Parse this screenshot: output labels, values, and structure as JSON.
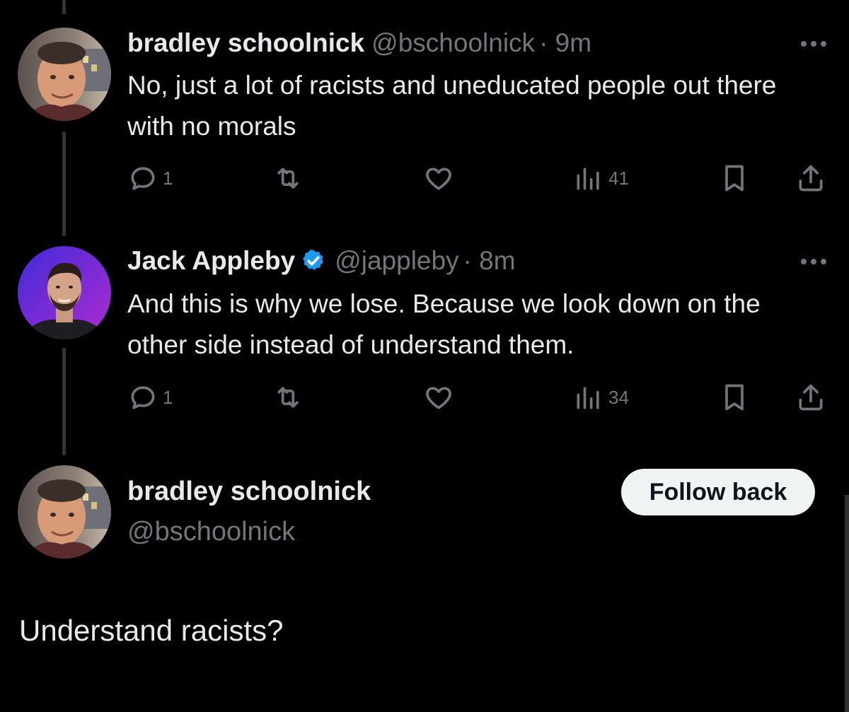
{
  "tweets": [
    {
      "name": "bradley schoolnick",
      "handle": "@bschoolnick",
      "time": "· 9m",
      "text": "No, just a lot of racists and uneducated people out there with no morals",
      "replies": "1",
      "retweets": "",
      "likes": "",
      "views": "41",
      "verified": false
    },
    {
      "name": "Jack Appleby",
      "handle": "@jappleby",
      "time": "· 8m",
      "text": "And this is why we lose. Because we look down on the other side instead of understand them.",
      "replies": "1",
      "retweets": "",
      "likes": "",
      "views": "34",
      "verified": true
    }
  ],
  "reply_compose": {
    "name": "bradley schoolnick",
    "handle": "@bschoolnick",
    "follow_button": "Follow back",
    "text": "Understand racists?"
  },
  "icons": {
    "reply": "reply-icon",
    "retweet": "retweet-icon",
    "like": "heart-icon",
    "views": "views-icon",
    "bookmark": "bookmark-icon",
    "share": "share-icon",
    "more": "more-icon",
    "verified": "verified-badge-icon"
  },
  "colors": {
    "background": "#000000",
    "text_primary": "#e7e9ea",
    "text_secondary": "#71767b",
    "verified": "#1d9bf0",
    "button_bg": "#eff3f4"
  }
}
